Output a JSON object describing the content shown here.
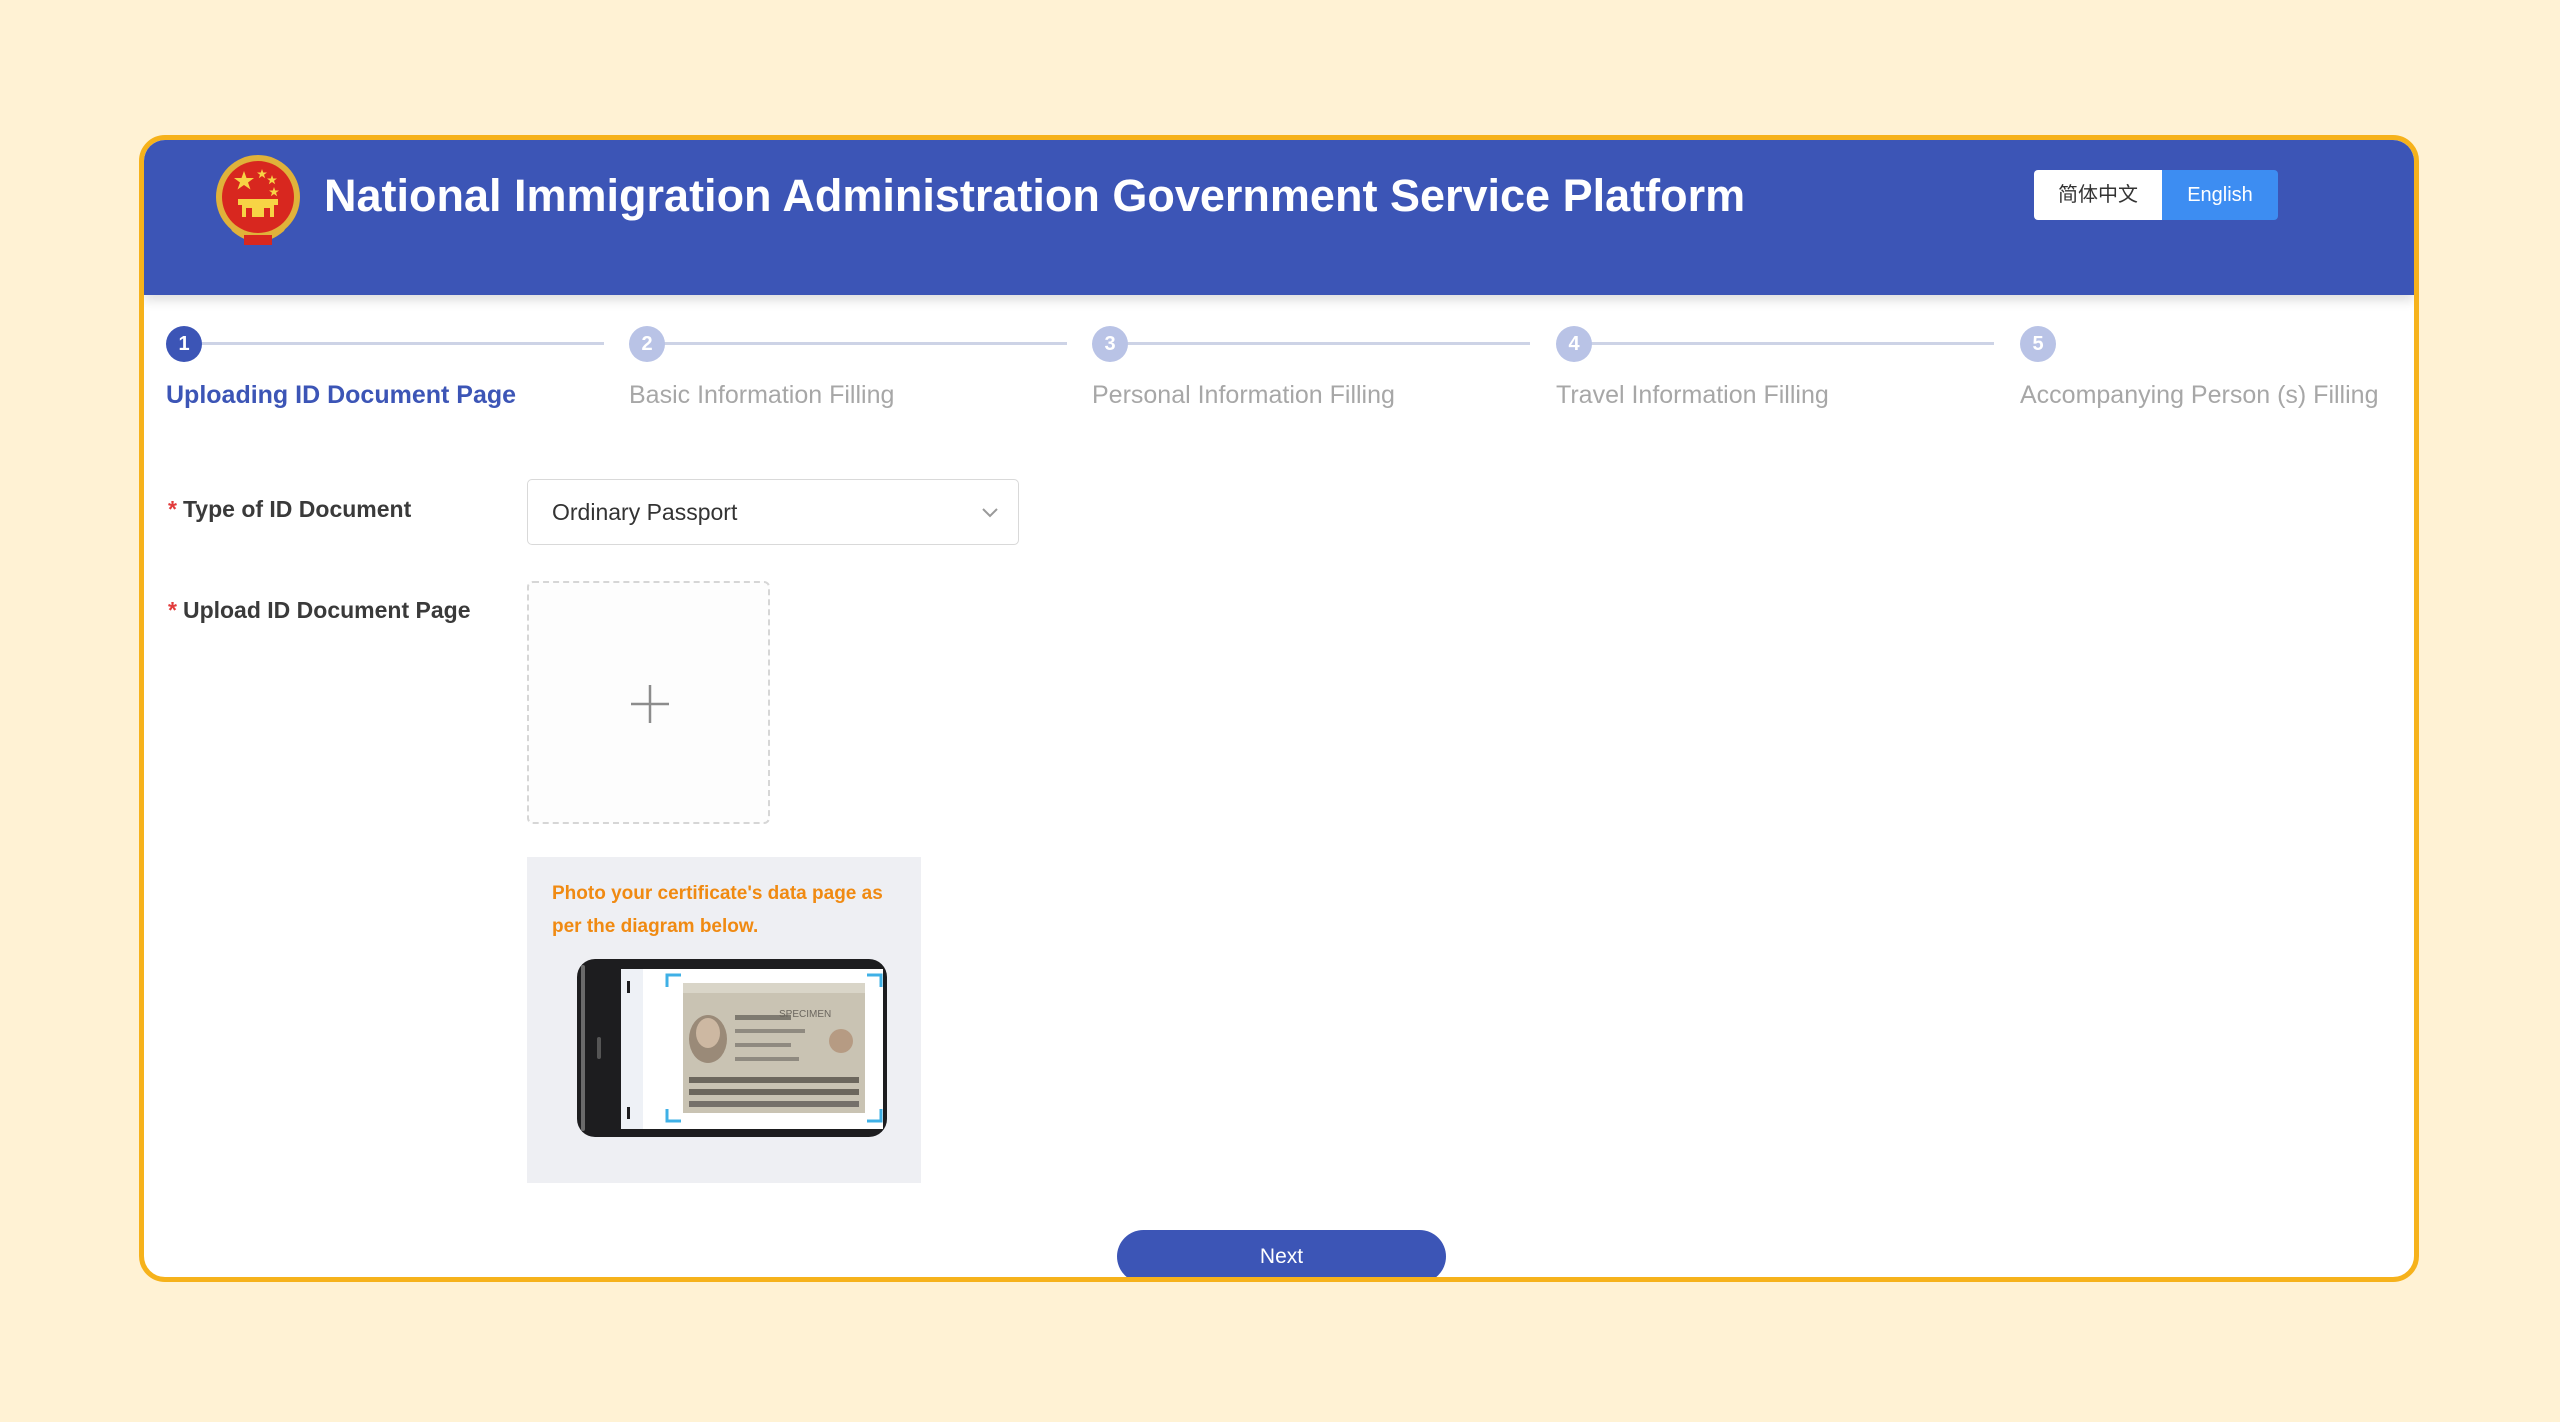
{
  "header": {
    "title": "National Immigration Administration Government Service Platform",
    "lang_cn": "简体中文",
    "lang_en": "English",
    "emblem_icon": "national-emblem-icon"
  },
  "steps": [
    {
      "number": "1",
      "label": "Uploading ID Document Page",
      "active": true
    },
    {
      "number": "2",
      "label": "Basic Information Filling",
      "active": false
    },
    {
      "number": "3",
      "label": "Personal Information Filling",
      "active": false
    },
    {
      "number": "4",
      "label": "Travel Information Filling",
      "active": false
    },
    {
      "number": "5",
      "label": "Accompanying Person (s) Filling",
      "active": false
    }
  ],
  "form": {
    "required_mark": "*",
    "doc_type_label": "Type of ID Document",
    "doc_type_value": "Ordinary Passport",
    "upload_label": "Upload ID Document Page",
    "hint": "Photo your certificate's data page as per the diagram below.",
    "sample_specimen": "SPECIMEN"
  },
  "actions": {
    "next_label": "Next"
  },
  "colors": {
    "primary": "#3c55b6",
    "frame": "#f6b21b",
    "background": "#fff2d4",
    "hint": "#f08a12",
    "required": "#e23b3b",
    "lang_active": "#3d8df2"
  }
}
